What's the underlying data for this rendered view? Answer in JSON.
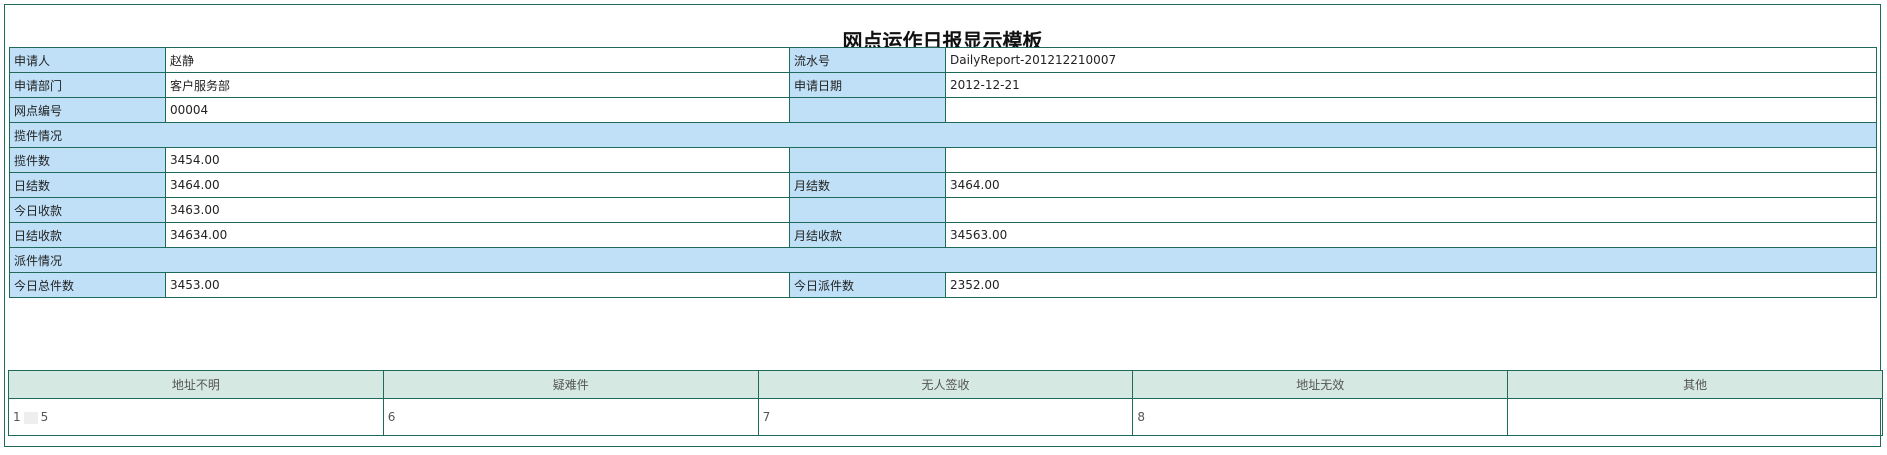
{
  "title": "网点运作日报显示模板",
  "rows": {
    "applicant": {
      "label": "申请人",
      "value": "赵静"
    },
    "serial": {
      "label": "流水号",
      "value": "DailyReport-201212210007"
    },
    "department": {
      "label": "申请部门",
      "value": "客户服务部"
    },
    "date": {
      "label": "申请日期",
      "value": "2012-12-21"
    },
    "branch_no": {
      "label": "网点编号",
      "value": "00004"
    },
    "pickup_section": "揽件情况",
    "pickup_count": {
      "label": "揽件数",
      "value": "3454.00"
    },
    "daily_settle": {
      "label": "日结数",
      "value": "3464.00"
    },
    "monthly_settle": {
      "label": "月结数",
      "value": "3464.00"
    },
    "today_receipt": {
      "label": "今日收款",
      "value": "3463.00"
    },
    "daily_receipt": {
      "label": "日结收款",
      "value": "34634.00"
    },
    "monthly_receipt": {
      "label": "月结收款",
      "value": "34563.00"
    },
    "delivery_section": "派件情况",
    "today_total": {
      "label": "今日总件数",
      "value": "3453.00"
    },
    "today_delivered": {
      "label": "今日派件数",
      "value": "2352.00"
    }
  },
  "stats": {
    "headers": [
      "地址不明",
      "疑难件",
      "无人签收",
      "地址无效",
      "其他"
    ],
    "values": [
      "5",
      "6",
      "7",
      "8",
      ""
    ],
    "first_prefix": "1"
  }
}
